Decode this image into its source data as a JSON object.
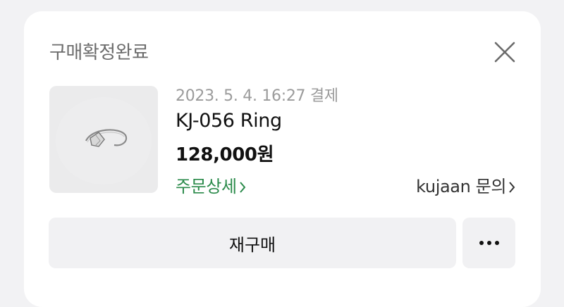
{
  "order": {
    "status_title": "구매확정완료",
    "date": "2023. 5. 4. 16:27 결제",
    "product_name": "KJ-056 Ring",
    "price": "128,000원",
    "order_detail_label": "주문상세",
    "seller_inquiry_label": "kujaan 문의"
  },
  "actions": {
    "rebuy_label": "재구매",
    "more_label": "•••"
  },
  "icons": {
    "close": "close-icon",
    "chevron": "chevron-right-icon",
    "more": "more-dots-icon"
  },
  "colors": {
    "background": "#f2f2f4",
    "card": "#ffffff",
    "accent_green": "#2a8a4a",
    "button_bg": "#f1f1f3"
  }
}
